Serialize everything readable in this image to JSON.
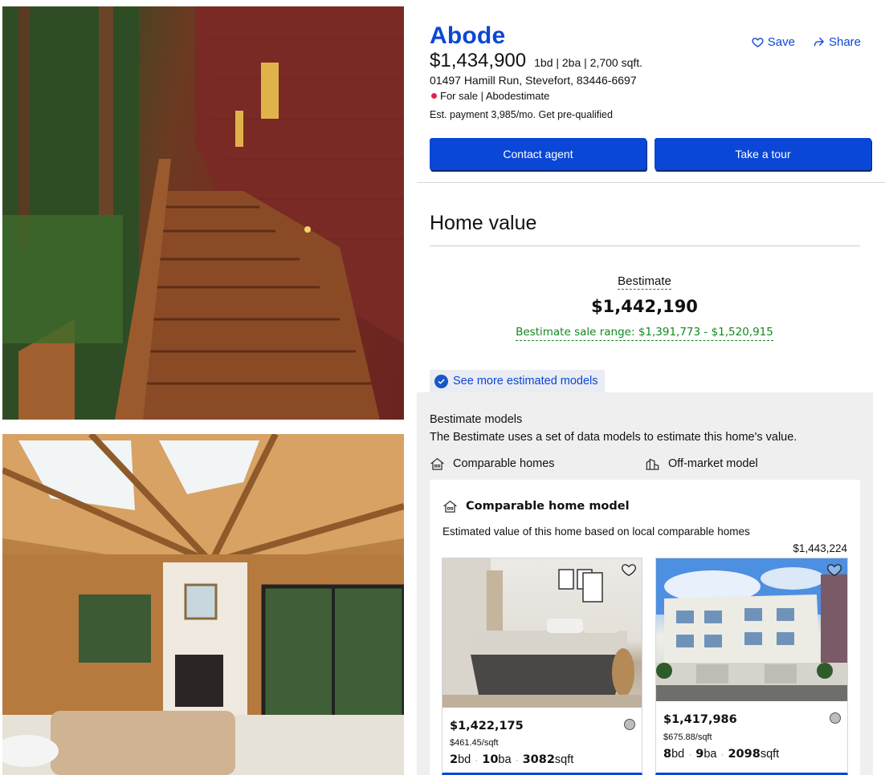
{
  "listing": {
    "brand": "Abode",
    "price": "$1,434,900",
    "facts": "1bd | 2ba | 2,700 sqft.",
    "address": "01497 Hamill Run, Stevefort, 83446-6697",
    "status": "For sale | Abodestimate",
    "payment": "Est. payment 3,985/mo. Get pre-qualified"
  },
  "actions": {
    "save": "Save",
    "share": "Share"
  },
  "buttons": {
    "contact": "Contact agent",
    "tour": "Take a tour"
  },
  "home_value": {
    "title": "Home value",
    "estimate_label": "Bestimate",
    "estimate_value": "$1,442,190",
    "range": "Bestimate sale range: $1,391,773 - $1,520,915",
    "see_more": "See more estimated models"
  },
  "models": {
    "title": "Bestimate models",
    "description": "The Bestimate uses a set of data models to estimate this home's value.",
    "tabs": [
      "Comparable homes",
      "Off-market model"
    ],
    "card": {
      "title": "Comparable home model",
      "description": "Estimated value of this home based on local comparable homes",
      "value": "$1,443,224",
      "comps": [
        {
          "price": "$1,422,175",
          "per_sqft": "$461.45/sqft",
          "beds": "2",
          "beds_unit": "bd",
          "baths": "10",
          "baths_unit": "ba",
          "sqft": "3082",
          "sqft_unit": "sqft",
          "image": "bedroom-photo"
        },
        {
          "price": "$1,417,986",
          "per_sqft": "$675.88/sqft",
          "beds": "8",
          "beds_unit": "bd",
          "baths": "9",
          "baths_unit": "ba",
          "sqft": "2098",
          "sqft_unit": "sqft",
          "image": "apartment-building-photo"
        }
      ]
    }
  },
  "colors": {
    "accent": "#0b47d6",
    "status_dot": "#e3214a",
    "range_green": "#118a1d",
    "panel_gray": "#efefef"
  }
}
